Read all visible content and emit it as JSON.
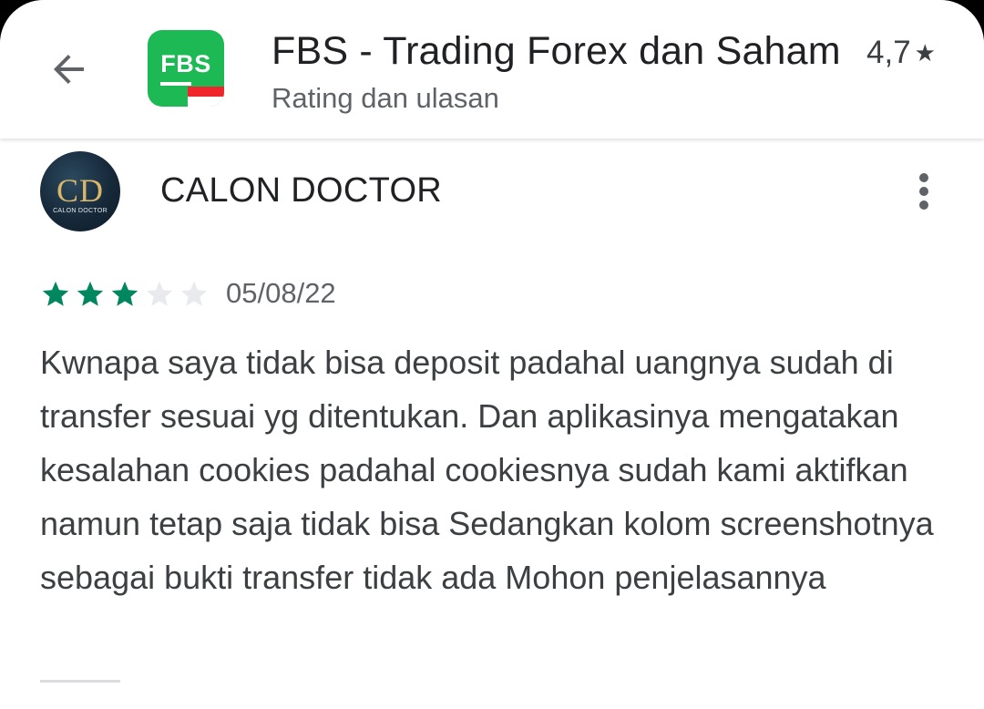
{
  "header": {
    "back_icon": "arrow-left-icon",
    "app_icon": {
      "logo_text": "FBS",
      "background": "#1db954",
      "flag_colors": [
        "#f0262d",
        "#ffffff"
      ]
    },
    "title": "FBS - Trading Forex dan Saham",
    "subtitle": "Rating dan ulasan",
    "rating": "4,7",
    "rating_icon": "star-icon"
  },
  "review": {
    "avatar": {
      "monogram": "CD",
      "caption": "CALON DOCTOR"
    },
    "reviewer_name": "CALON DOCTOR",
    "more_icon": "more-vert-icon",
    "rating_stars": 3,
    "max_stars": 5,
    "date": "05/08/22",
    "text": "Kwnapa saya tidak bisa deposit padahal uangnya sudah di transfer sesuai yg ditentukan. Dan aplikasinya mengatakan kesalahan cookies padahal cookiesnya sudah kami aktifkan namun tetap saja tidak bisa Sedangkan kolom screenshotnya sebagai bukti transfer tidak ada Mohon penjelasannya"
  },
  "colors": {
    "star_filled": "#01875f",
    "star_empty": "#e8eaed",
    "text_primary": "#202124",
    "text_secondary": "#5f6368"
  }
}
